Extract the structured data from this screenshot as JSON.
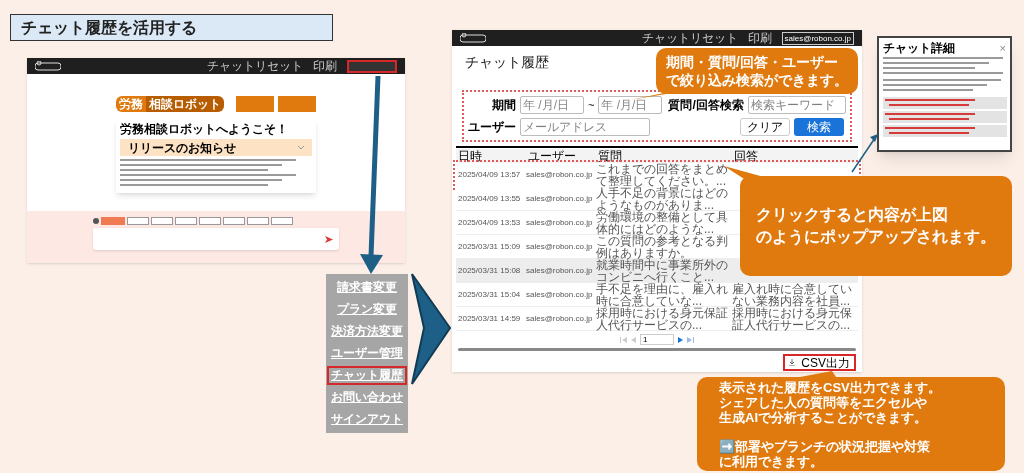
{
  "title": "チェット履歴を活用する",
  "left_screen": {
    "header_links": [
      "チャットリセット",
      "印刷"
    ],
    "logo": {
      "left": "労務",
      "right": "相談ロボット"
    },
    "welcome": "労務相談ロボットへようこそ！",
    "notice": "リリースのお知らせ",
    "category_chips": [
      {
        "selected": true
      },
      {
        "selected": false
      },
      {
        "selected": false
      },
      {
        "selected": false
      },
      {
        "selected": false
      },
      {
        "selected": false
      },
      {
        "selected": false
      },
      {
        "selected": false
      }
    ]
  },
  "account_menu": [
    {
      "label": "請求書変更",
      "selected": false
    },
    {
      "label": "プラン変更",
      "selected": false
    },
    {
      "label": "決済方法変更",
      "selected": false
    },
    {
      "label": "ユーザー管理",
      "selected": false
    },
    {
      "label": "チャット履歴",
      "selected": true
    },
    {
      "label": "お問い合わせ",
      "selected": false
    },
    {
      "label": "サインアウト",
      "selected": false
    }
  ],
  "history_screen": {
    "header_links": [
      "チャットリセット",
      "印刷"
    ],
    "account": "sales@robon.co.jp",
    "page_title": "チャット履歴",
    "filters": {
      "period_label": "期間",
      "date_from_placeholder": "年 /月/日",
      "range_separator": "~",
      "date_to_placeholder": "年 /月/日",
      "search_label": "質問/回答検索",
      "search_placeholder": "検索キーワード",
      "user_label": "ユーザー",
      "user_placeholder": "メールアドレス",
      "clear_button": "クリア",
      "search_button": "検索"
    },
    "table": {
      "columns": [
        "日時",
        "ユーザー",
        "質問",
        "回答"
      ],
      "rows": [
        {
          "date": "2025/04/09 13:57",
          "user": "sales@robon.co.jp",
          "question": "これまでの回答をまとめて整理してください。...",
          "outlined": true,
          "hovered": false
        },
        {
          "date": "2025/04/09 13:55",
          "user": "sales@robon.co.jp",
          "question": "人手不足の背景にはどのようなものがありま...",
          "outlined": false,
          "hovered": false
        },
        {
          "date": "2025/04/09 13:53",
          "user": "sales@robon.co.jp",
          "question": "労働環境の整備として具体的にはどのような...",
          "outlined": false,
          "hovered": false
        },
        {
          "date": "2025/03/31 15:09",
          "user": "sales@robon.co.jp",
          "question": "この質問の参考となる判例はありますか。",
          "outlined": false,
          "hovered": false
        },
        {
          "date": "2025/03/31 15:08",
          "user": "sales@robon.co.jp",
          "question": "就業時間中に事業所外のコンビニへ行くこと...",
          "outlined": false,
          "hovered": true
        },
        {
          "date": "2025/03/31 15:04",
          "user": "sales@robon.co.jp",
          "question": "手不足を理由に、雇入れ時に合意していな...",
          "answer": "雇入れ時に合意していない業務内容を社員...",
          "outlined": false,
          "hovered": false
        },
        {
          "date": "2025/03/31 14:59",
          "user": "sales@robon.co.jp",
          "question": "採用時における身元保証人代行サービスの...",
          "answer": "採用時における身元保証人代行サービスの...",
          "outlined": false,
          "hovered": false
        }
      ]
    },
    "pagination": {
      "page": "1"
    },
    "csv_button": "CSV出力"
  },
  "detail_popup": {
    "title": "チャット詳細",
    "close": "×"
  },
  "callouts": [
    {
      "paragraphs": [
        [
          "期間・質問/回答・ユーザー",
          "で絞り込み検索ができます。"
        ]
      ]
    },
    {
      "paragraphs": [
        [
          "クリックすると内容が上図",
          "のようにポップアップされます。"
        ]
      ]
    },
    {
      "paragraphs": [
        [
          "表示された履歴をCSV出力できます。",
          "シェアした人の質問等をエクセルや",
          "生成AIで分析することができます。"
        ],
        [
          "➡️部署やブランチの状況把握や対策",
          "に利用できます。"
        ]
      ]
    }
  ]
}
